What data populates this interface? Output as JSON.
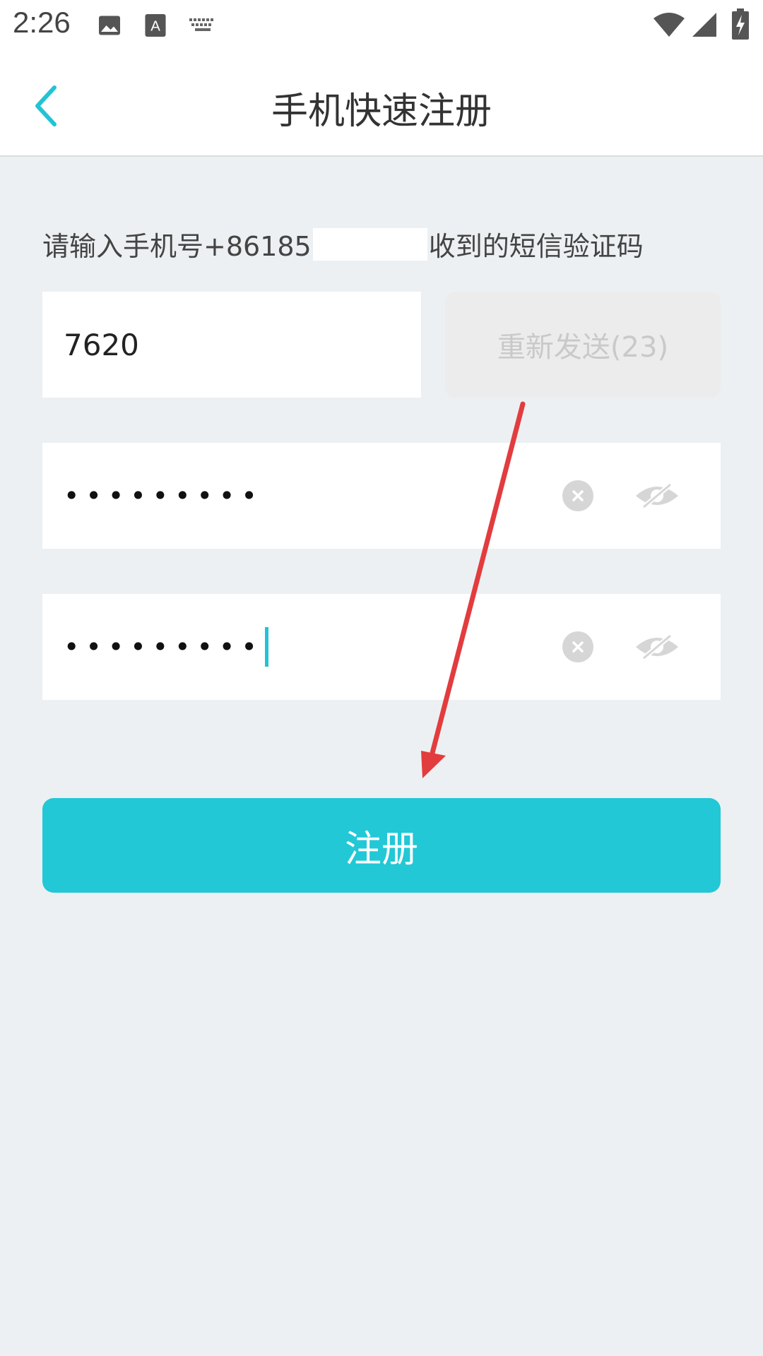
{
  "status_bar": {
    "time": "2:26",
    "left_icons": [
      "image-icon",
      "text-a-icon",
      "keyboard-icon"
    ],
    "right_icons": [
      "wifi-icon",
      "signal-icon",
      "battery-charging-icon"
    ]
  },
  "header": {
    "title": "手机快速注册",
    "back_icon": "chevron-left-icon"
  },
  "prompt": {
    "prefix": "请输入手机号+86185",
    "suffix": "收到的短信验证码"
  },
  "code_field": {
    "value": "7620"
  },
  "resend_button": {
    "label": "重新发送(23)"
  },
  "password_fields": [
    {
      "value": "•••••••••"
    },
    {
      "value": "•••••••••"
    }
  ],
  "register_button": {
    "label": "注册"
  },
  "colors": {
    "accent": "#22c8d6",
    "background": "#edf0f2",
    "annotation_arrow": "#e23c3f"
  }
}
